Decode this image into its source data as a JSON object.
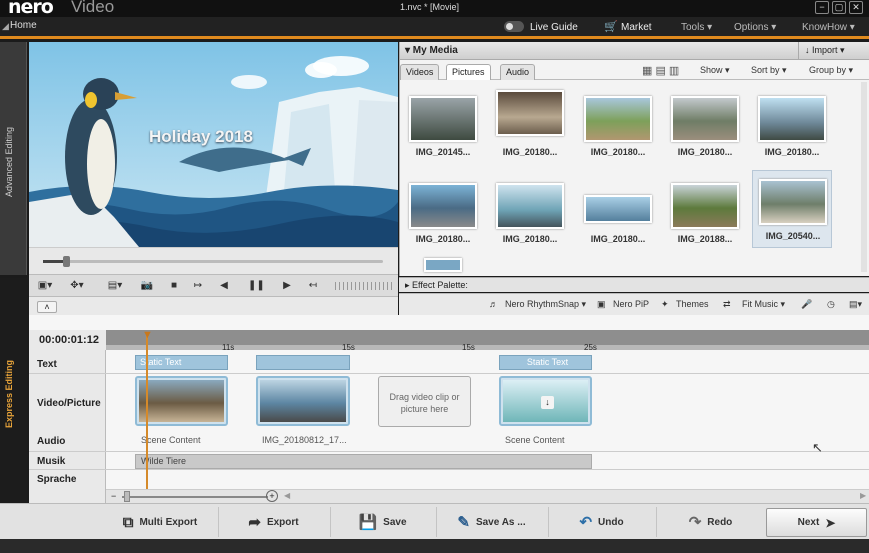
{
  "app": {
    "logo": "nero",
    "name": "Video",
    "doc_title": "1.nvc * [Movie]"
  },
  "window_buttons": [
    "−",
    "▢",
    "✕"
  ],
  "menubar": {
    "home": "Home",
    "live_guide": "Live Guide",
    "market": "Market",
    "tools": "Tools ▾",
    "options": "Options ▾",
    "knowhow": "KnowHow ▾"
  },
  "side": {
    "advanced": "Advanced Editing",
    "express": "Express Editing"
  },
  "preview": {
    "overlay_title": "Holiday 2018"
  },
  "media": {
    "title": "▾ My Media",
    "import_label": "↓ Import ▾",
    "tabs": [
      "Videos",
      "Pictures",
      "Audio"
    ],
    "active_tab": "Pictures",
    "show_label": "Show ▾",
    "sort_label": "Sort by ▾",
    "group_label": "Group by ▾",
    "thumbnails": [
      "IMG_20145...",
      "IMG_20180...",
      "IMG_20180...",
      "IMG_20180...",
      "IMG_20180...",
      "IMG_20180...",
      "IMG_20180...",
      "IMG_20180...",
      "IMG_20188...",
      "IMG_20540..."
    ]
  },
  "effect_palette": "▸ Effect Palette:",
  "toolbar": {
    "rhythmsnap": "Nero RhythmSnap ▾",
    "pip": "Nero PiP",
    "themes": "Themes",
    "fitmusic": "Fit Music ▾"
  },
  "timeline": {
    "timecode": "00:00:01:12",
    "ticks": [
      "11s",
      "15s",
      "15s",
      "25s"
    ],
    "rows": [
      "Text",
      "Video/Picture",
      "Audio",
      "Musik",
      "Sprache"
    ],
    "text_clips": [
      "Static Text",
      "",
      "Static Text"
    ],
    "video_captions": [
      "Scene Content",
      "IMG_20180812_17...",
      "Scene Content"
    ],
    "drop_hint": "Drag video clip or picture here",
    "music_clip": "Wilde Tiere"
  },
  "bottom": {
    "multi_export": "Multi Export",
    "export": "Export",
    "save": "Save",
    "save_as": "Save As ...",
    "undo": "Undo",
    "redo": "Redo",
    "next": "Next"
  },
  "colors": {
    "accent": "#e08a1e",
    "clip_blue": "#9fc4dc",
    "playhead": "#d58a2a"
  }
}
